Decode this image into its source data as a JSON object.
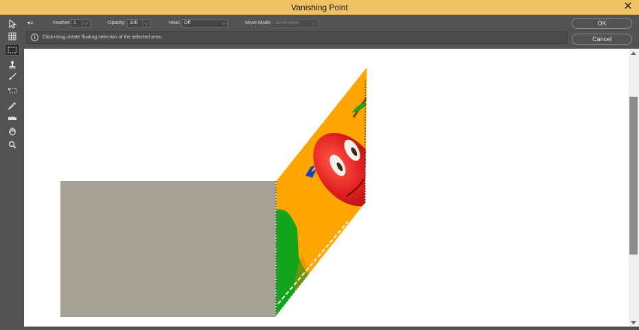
{
  "window": {
    "title": "Vanishing Point",
    "close_label": "✕"
  },
  "options": {
    "menu_label": "▾≡",
    "feather_label": "Feather:",
    "feather_value": "1",
    "opacity_label": "Opacity:",
    "opacity_value": "100",
    "heal_label": "Heal:",
    "heal_value": "Off",
    "move_mode_label": "Move Mode:",
    "move_mode_value": "Destination",
    "dropdown_glyph": "⌵"
  },
  "info": {
    "icon_glyph": "i",
    "text": "Click+drag create floating selection of the selected area."
  },
  "buttons": {
    "ok": "OK",
    "cancel": "Cancel"
  },
  "tools": [
    {
      "name": "edit-plane-tool",
      "icon": "arrow-icon"
    },
    {
      "name": "create-plane-tool",
      "icon": "grid-icon"
    },
    {
      "name": "marquee-tool",
      "icon": "marquee-icon",
      "active": true
    },
    {
      "name": "stamp-tool",
      "icon": "stamp-icon"
    },
    {
      "name": "brush-tool",
      "icon": "brush-icon"
    },
    {
      "name": "transform-tool",
      "icon": "transform-icon"
    },
    {
      "name": "eyedropper-tool",
      "icon": "eyedropper-icon"
    },
    {
      "name": "measure-tool",
      "icon": "ruler-icon"
    },
    {
      "name": "hand-tool",
      "icon": "hand-icon"
    },
    {
      "name": "zoom-tool",
      "icon": "zoom-icon"
    }
  ],
  "colors": {
    "title_bar": "#f0c163",
    "panel": "#535353",
    "gray_plane": "#a6a394",
    "orange": "#ffa500",
    "green": "#10a51a",
    "red": "#e01f1f"
  }
}
